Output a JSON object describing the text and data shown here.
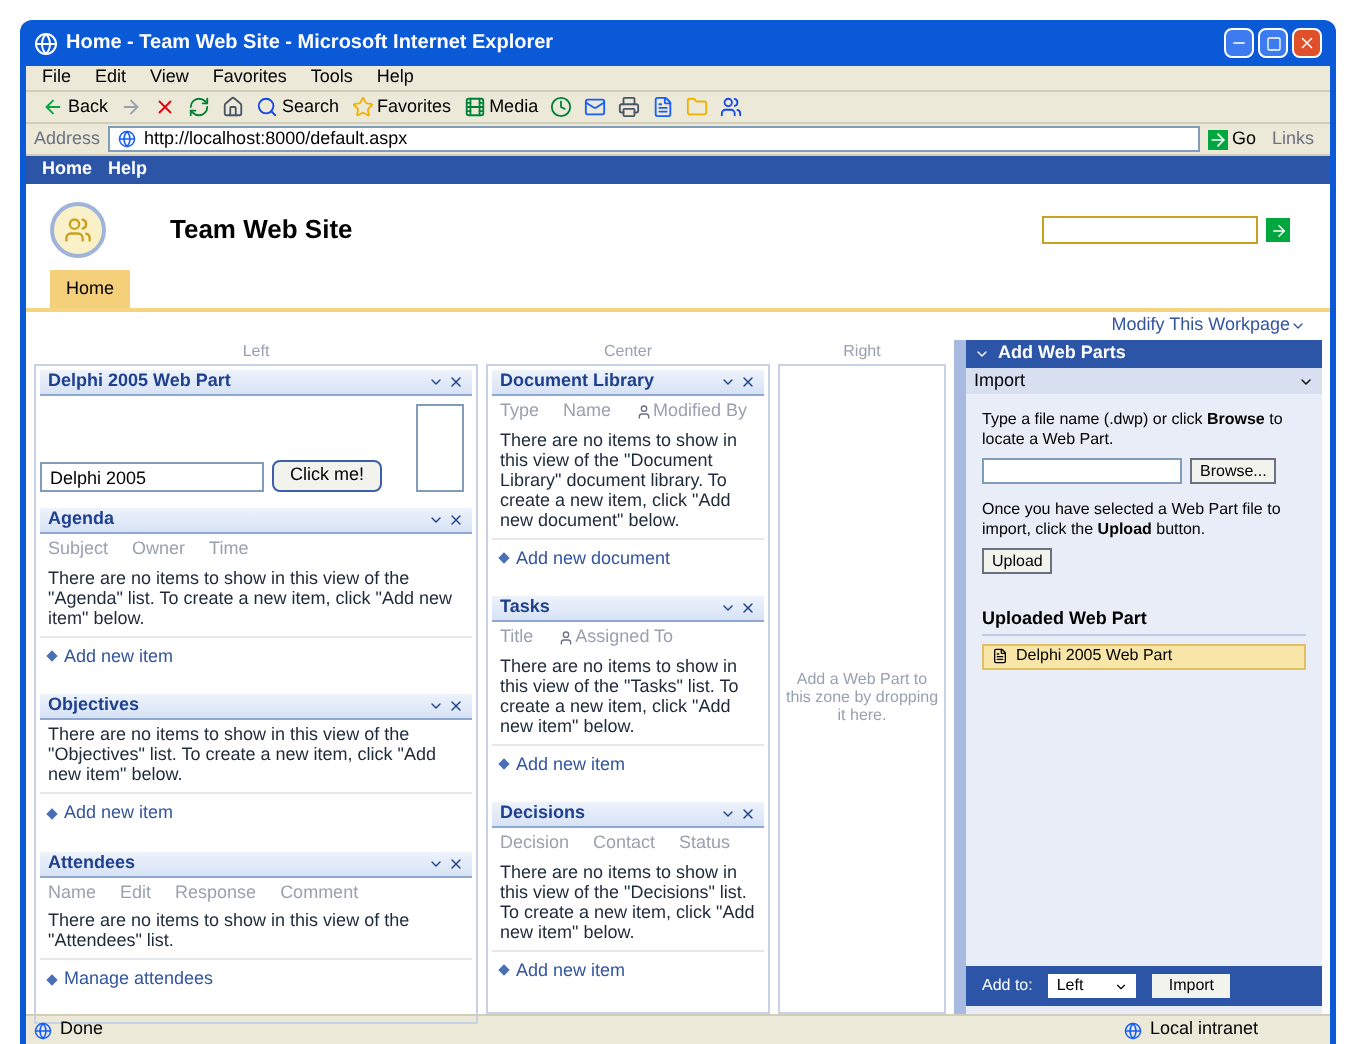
{
  "window": {
    "title": "Home - Team Web Site - Microsoft Internet Explorer"
  },
  "menu": [
    "File",
    "Edit",
    "View",
    "Favorites",
    "Tools",
    "Help"
  ],
  "toolbar": [
    {
      "kind": "back",
      "label": "Back"
    },
    {
      "kind": "forward"
    },
    {
      "kind": "stop"
    },
    {
      "kind": "refresh"
    },
    {
      "kind": "home"
    },
    {
      "kind": "search",
      "label": "Search"
    },
    {
      "kind": "favorites",
      "label": "Favorites"
    },
    {
      "kind": "media",
      "label": "Media"
    },
    {
      "kind": "history"
    },
    {
      "kind": "mail"
    },
    {
      "kind": "print"
    },
    {
      "kind": "edit"
    },
    {
      "kind": "folder"
    },
    {
      "kind": "messenger"
    }
  ],
  "address": {
    "label": "Address",
    "url": "http://localhost:8000/default.aspx",
    "go": "Go",
    "links": "Links"
  },
  "top_links": [
    "Home",
    "Help"
  ],
  "site_title": "Team Web Site",
  "tabs": [
    {
      "label": "Home",
      "selected": true
    }
  ],
  "modify_link": "Modify This Workpage",
  "zones": [
    {
      "label": "Left",
      "parts": [
        {
          "kind": "custom",
          "title": "Delphi 2005 Web Part",
          "value": "Delphi 2005",
          "button": "Click me!"
        },
        {
          "kind": "list",
          "title": "Agenda",
          "columns": [
            {
              "label": "Subject",
              "kind": "text"
            },
            {
              "label": "Owner",
              "kind": "text"
            },
            {
              "label": "Time",
              "kind": "text"
            }
          ],
          "message": "There are no items to show in this view of the \"Agenda\" list. To create a new item, click \"Add new item\" below.",
          "link": "Add new item"
        },
        {
          "kind": "list",
          "title": "Objectives",
          "message": "There are no items to show in this view of the \"Objectives\" list. To create a new item, click \"Add new item\" below.",
          "link": "Add new item"
        },
        {
          "kind": "list",
          "title": "Attendees",
          "columns": [
            {
              "label": "Name",
              "kind": "text"
            },
            {
              "label": "Edit",
              "kind": "text"
            },
            {
              "label": "Response",
              "kind": "text"
            },
            {
              "label": "Comment",
              "kind": "text"
            }
          ],
          "message": "There are no items to show in this view of the \"Attendees\" list.",
          "link": "Manage attendees"
        }
      ]
    },
    {
      "label": "Center",
      "parts": [
        {
          "kind": "list",
          "title": "Document Library",
          "columns": [
            {
              "label": "Type",
              "kind": "text"
            },
            {
              "label": "Name",
              "kind": "text"
            },
            {
              "label": "Modified By",
              "kind": "person"
            }
          ],
          "message": "There are no items to show in this view of the \"Document Library\" document library. To create a new item, click \"Add new document\" below.",
          "link": "Add new document"
        },
        {
          "kind": "list",
          "title": "Tasks",
          "columns": [
            {
              "label": "Title",
              "kind": "text"
            },
            {
              "label": "Assigned To",
              "kind": "person"
            }
          ],
          "message": "There are no items to show in this view of the \"Tasks\" list. To create a new item, click \"Add new item\" below.",
          "link": "Add new item"
        },
        {
          "kind": "list",
          "title": "Decisions",
          "columns": [
            {
              "label": "Decision",
              "kind": "text"
            },
            {
              "label": "Contact",
              "kind": "text"
            },
            {
              "label": "Status",
              "kind": "text"
            }
          ],
          "message": "There are no items to show in this view of the \"Decisions\" list. To create a new item, click \"Add new item\" below.",
          "link": "Add new item"
        }
      ]
    },
    {
      "label": "Right",
      "hint": "Add a Web Part to this zone by dropping it here."
    }
  ],
  "tool_pane": {
    "title": "Add Web Parts",
    "section": "Import",
    "instructions": "Type a file name (.dwp) or click **Browse** to locate a Web Part.",
    "browse": "Browse...",
    "upload_text": "Once you have selected a Web Part file to import, click the **Upload** button.",
    "upload": "Upload",
    "uploaded_title": "Uploaded Web Part",
    "uploaded": [
      "Delphi 2005 Web Part"
    ],
    "add_to": "Add to:",
    "zone": "Left",
    "import": "Import"
  },
  "status_bar": {
    "text": "Done",
    "zone": "Local intranet"
  }
}
